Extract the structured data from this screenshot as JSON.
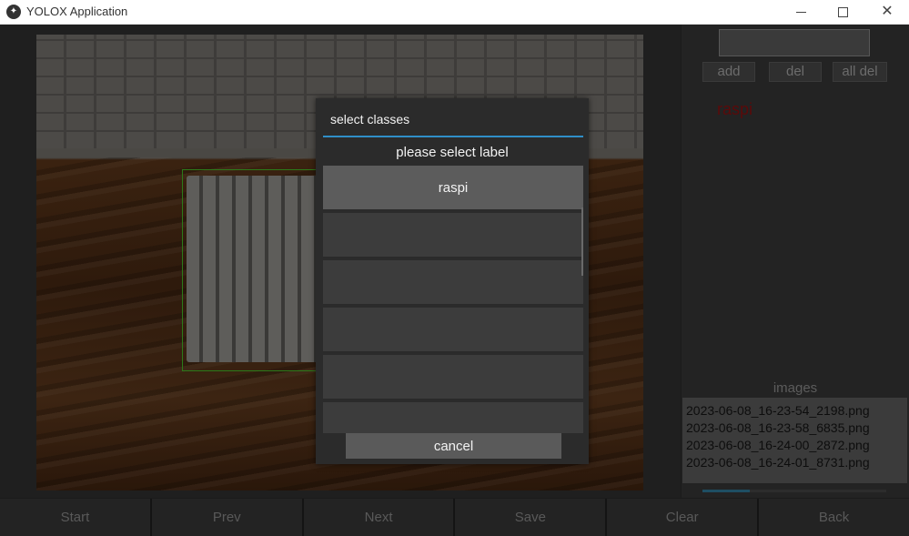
{
  "window": {
    "title": "YOLOX Application",
    "close_glyph": "✕"
  },
  "right_panel": {
    "input_value": "",
    "add_label": "add",
    "del_label": "del",
    "all_del_label": "all del",
    "current_class": "raspi",
    "images_heading": "images",
    "images": [
      "2023-06-08_16-23-54_2198.png",
      "2023-06-08_16-23-58_6835.png",
      "2023-06-08_16-24-00_2872.png",
      "2023-06-08_16-24-01_8731.png"
    ]
  },
  "toolbar": {
    "start": "Start",
    "prev": "Prev",
    "next": "Next",
    "save": "Save",
    "clear": "Clear",
    "back": "Back"
  },
  "dialog": {
    "title": "select classes",
    "subtitle": "please select label",
    "items": [
      "raspi",
      "",
      "",
      "",
      "",
      ""
    ],
    "cancel_label": "cancel"
  },
  "colors": {
    "accent_line": "#2f8fc8",
    "class_label": "#5a0a0a",
    "bbox": "#2c7a1a"
  }
}
